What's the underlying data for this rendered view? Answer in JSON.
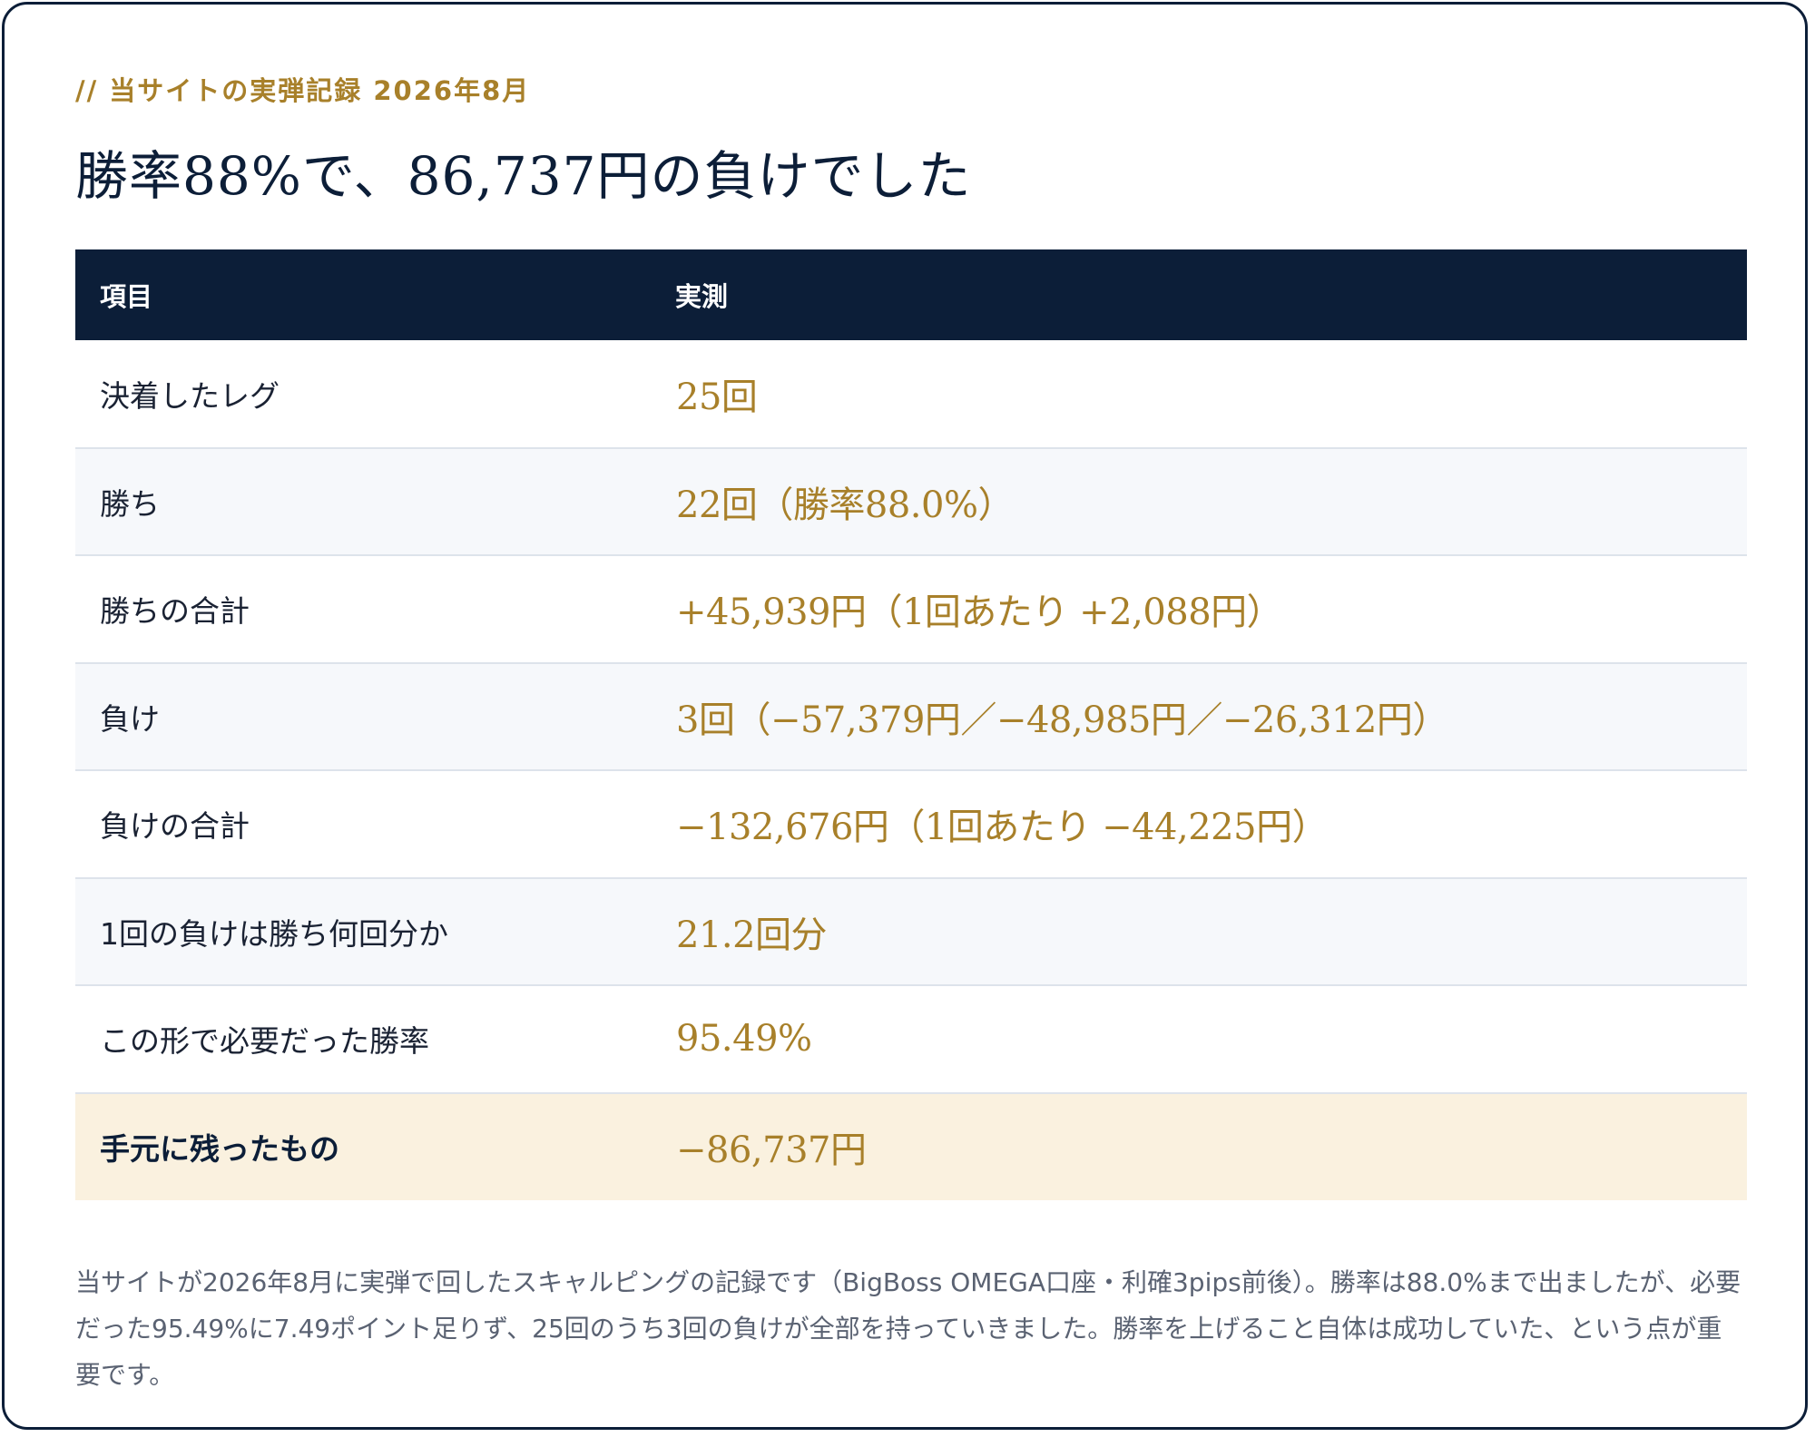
{
  "eyebrow": "// 当サイトの実弾記録 2026年8月",
  "headline": "勝率88%で、86,737円の負けでした",
  "table": {
    "headers": {
      "item": "項目",
      "value": "実測"
    },
    "rows": [
      {
        "label": "決着したレグ",
        "value": "25回"
      },
      {
        "label": "勝ち",
        "value": "22回（勝率88.0%）"
      },
      {
        "label": "勝ちの合計",
        "value": "+45,939円（1回あたり +2,088円）"
      },
      {
        "label": "負け",
        "value": "3回（−57,379円／−48,985円／−26,312円）"
      },
      {
        "label": "負けの合計",
        "value": "−132,676円（1回あたり −44,225円）"
      },
      {
        "label": "1回の負けは勝ち何回分か",
        "value": "21.2回分"
      },
      {
        "label": "この形で必要だった勝率",
        "value": "95.49%"
      }
    ],
    "final_row": {
      "label": "手元に残ったもの",
      "value": "−86,737円"
    }
  },
  "note": "当サイトが2026年8月に実弾で回したスキャルピングの記録です（BigBoss OMEGA口座・利確3pips前後）。勝率は88.0%まで出ましたが、必要だった95.49%に7.49ポイント足りず、25回のうち3回の負けが全部を持っていきました。勝率を上げること自体は成功していた、という点が重要です。",
  "colors": {
    "navy": "#0c1e38",
    "gold": "#a8802a",
    "highlight_row": "#faf1df",
    "stripe_row": "#f6f8fb"
  }
}
